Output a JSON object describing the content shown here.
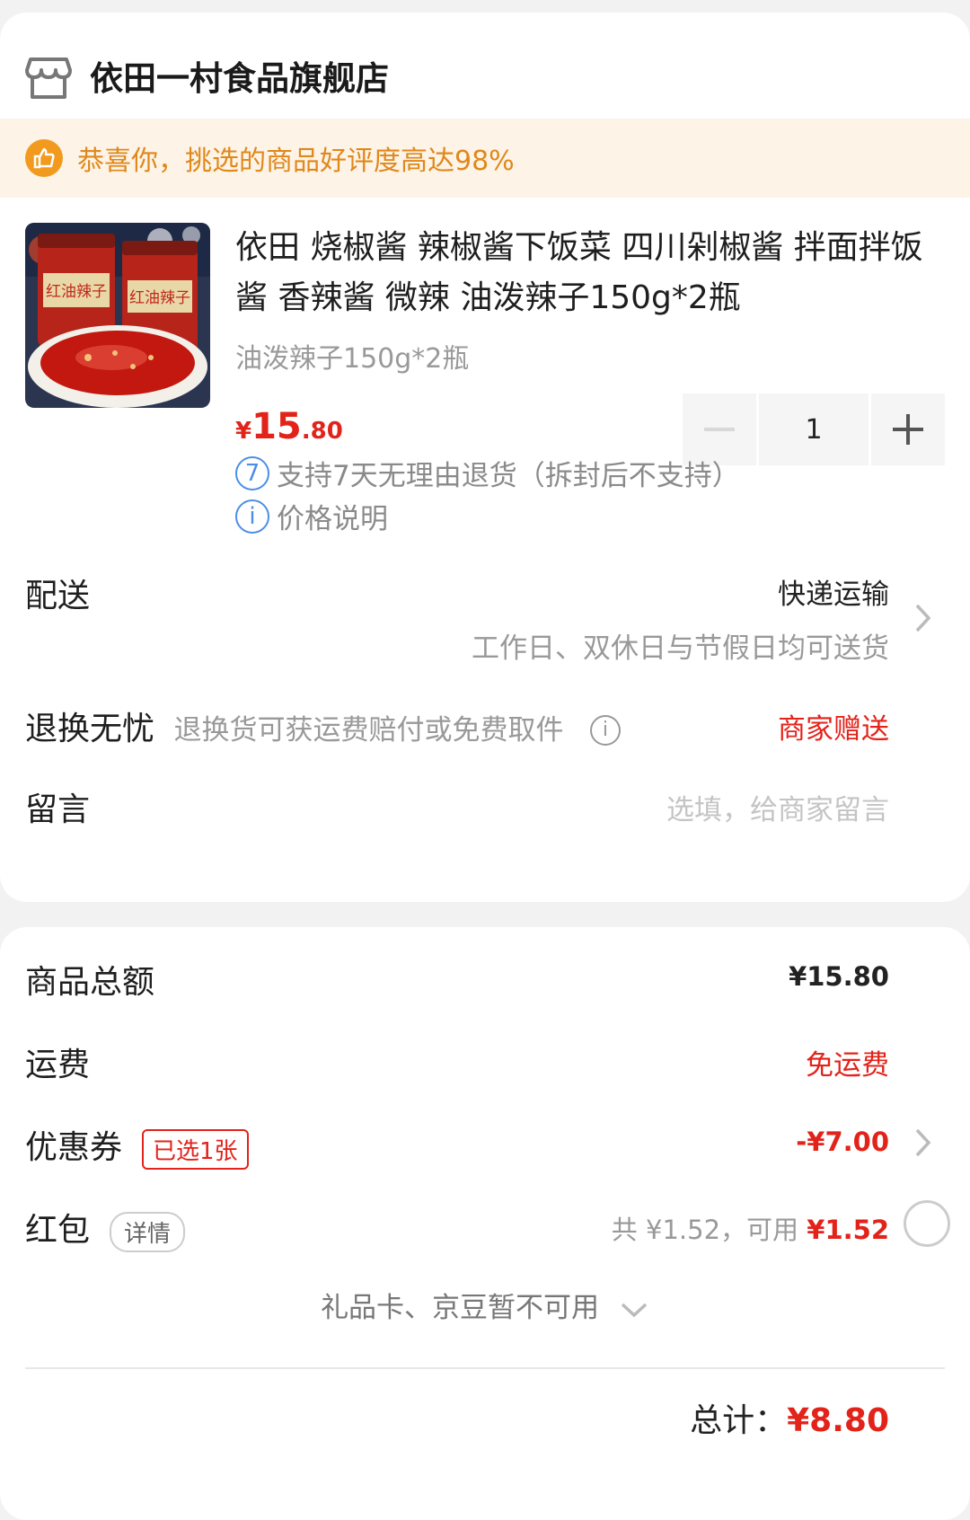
{
  "store": {
    "name": "依田一村食品旗舰店",
    "icon": "store-icon"
  },
  "banner": {
    "text": "恭喜你，挑选的商品好评度高达98%",
    "icon": "thumbs-up-icon",
    "color": "#e0881a"
  },
  "product": {
    "title": "依田 烧椒酱 辣椒酱下饭菜 四川剁椒酱 拌面拌饭酱 香辣酱 微辣 油泼辣子150g*2瓶",
    "spec": "油泼辣子150g*2瓶",
    "price_symbol": "¥",
    "price_int": "15",
    "price_dec": ".80",
    "jar_label": "红油辣子",
    "quantity": "1",
    "minus": "−",
    "plus": "+",
    "services": [
      {
        "badge": "7",
        "text": "支持7天无理由退货（拆封后不支持）"
      },
      {
        "badge": "i",
        "text": "价格说明"
      }
    ]
  },
  "delivery": {
    "label": "配送",
    "method": "快递运输",
    "note": "工作日、双休日与节假日均可送货"
  },
  "returns": {
    "label": "退换无忧",
    "desc": "退换货可获运费赔付或免费取件",
    "value": "商家赠送"
  },
  "message": {
    "label": "留言",
    "placeholder": "选填，给商家留言"
  },
  "summary": {
    "goods_total_label": "商品总额",
    "goods_total": "¥15.80",
    "shipping_label": "运费",
    "shipping": "免运费",
    "coupon_label": "优惠券",
    "coupon_tag": "已选1张",
    "coupon_value": "-¥7.00",
    "redpacket_label": "红包",
    "redpacket_tag": "详情",
    "redpacket_total_prefix": "共 ¥1.52，可用 ",
    "redpacket_available": "¥1.52",
    "giftcard_text": "礼品卡、京豆暂不可用",
    "total_label": "总计：",
    "total_value": "¥8.80"
  },
  "colors": {
    "accent_red": "#e2231a",
    "info_blue": "#4c8ee6",
    "banner_bg": "#fdf3e7"
  }
}
